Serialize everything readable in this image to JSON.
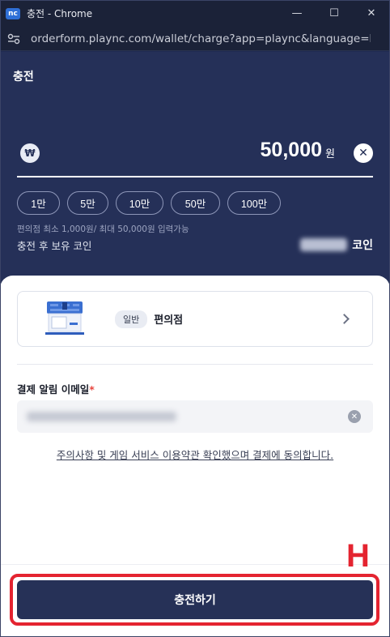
{
  "window": {
    "logo": "nc",
    "title": "충전 - Chrome",
    "controls": {
      "minimize": "—",
      "maximize": "☐",
      "close": "✕"
    }
  },
  "address_bar": {
    "url": "orderform.plaync.com/wallet/charge?app=plaync&language=ko-..."
  },
  "page": {
    "title": "충전",
    "currency_symbol": "₩",
    "amount": "50,000",
    "amount_unit": "원",
    "clear_symbol": "✕",
    "quick_amounts": [
      "1만",
      "5만",
      "10만",
      "50만",
      "100만"
    ],
    "hint": "편의점 최소 1,000원/ 최대 50,000원 입력가능",
    "after_charge_label": "충전 후 보유 코인",
    "after_charge_unit": "코인"
  },
  "payment_method": {
    "badge": "일반",
    "label": "편의점"
  },
  "email": {
    "label": "결제 알림 이메일",
    "required_mark": "*"
  },
  "terms_text": "주의사항 및 게임 서비스 이용약관 확인했으며 결제에 동의합니다.",
  "submit_label": "충전하기",
  "annotation_mark": "H",
  "colors": {
    "header_blue": "#253058",
    "button_blue": "#263157",
    "highlight_red": "#e42430",
    "required_red": "#e8463f"
  }
}
